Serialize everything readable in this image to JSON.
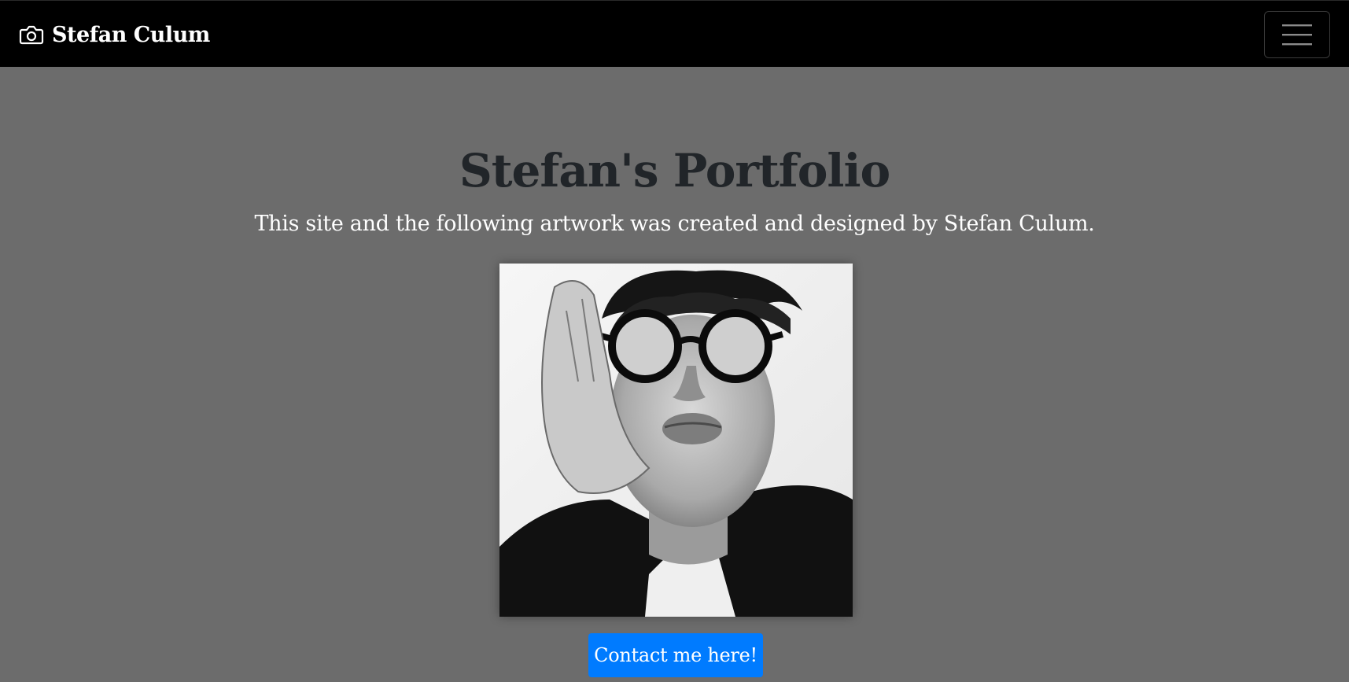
{
  "navbar": {
    "brand_label": "Stefan Culum",
    "brand_icon": "camera-icon",
    "toggler_icon": "hamburger-menu-icon",
    "background": "#000000"
  },
  "hero": {
    "title": "Stefan's Portfolio",
    "subtitle": "This site and the following artwork was created and designed by Stefan Culum.",
    "image_alt": "Black and white portrait of Stefan Culum wearing round glasses",
    "contact_button_label": "Contact me here!"
  },
  "colors": {
    "page_background": "#6c6c6c",
    "title_text": "#212529",
    "subtitle_text": "#ffffff",
    "button_primary": "#007bff"
  }
}
